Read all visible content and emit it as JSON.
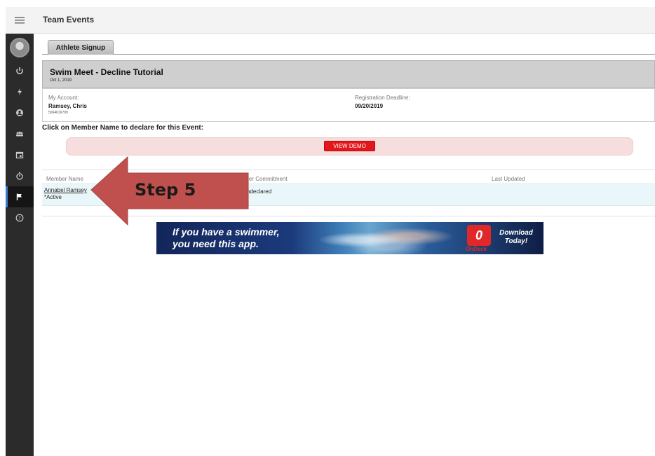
{
  "topbar": {
    "title": "Team Events"
  },
  "tabs": {
    "active": "Athlete Signup"
  },
  "event": {
    "title": "Swim Meet - Decline Tutorial",
    "date": "Oct 1, 2019",
    "account_label": "My Account:",
    "account_name": "Ramsey, Chris",
    "account_id": "5064616799",
    "deadline_label": "Registration Deadline:",
    "deadline_value": "09/20/2019"
  },
  "instructions": "Click on Member Name to declare for this Event:",
  "demo_button": "VIEW DEMO",
  "table": {
    "headers": [
      "Member Name",
      "nber Commitment",
      "Last Updated"
    ],
    "rows": [
      {
        "name": "Annabel Ramsey",
        "status": "*Active",
        "commitment": "ndeclared",
        "last_updated": ""
      }
    ]
  },
  "ad": {
    "line1": "If you have a swimmer,",
    "line2": "you need this app.",
    "logo_letter": "0",
    "logo_word": "OnDeck",
    "cta1": "Download",
    "cta2": "Today!"
  },
  "annotation": {
    "label": "Step 5",
    "color": "#c0504d"
  },
  "colors": {
    "sidebar": "#2b2b2b",
    "demo_button": "#e3161b",
    "row_highlight": "#eaf7fa"
  }
}
